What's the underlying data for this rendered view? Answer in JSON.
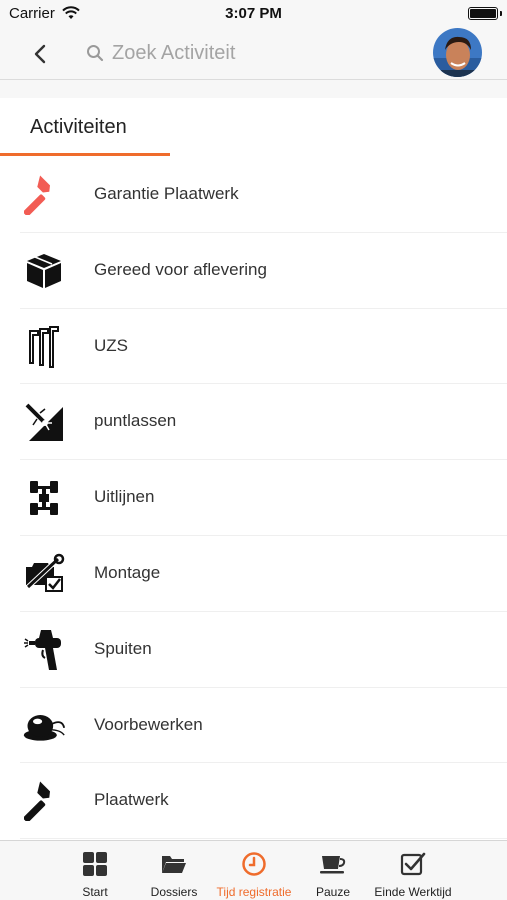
{
  "status_bar": {
    "carrier": "Carrier",
    "time": "3:07 PM"
  },
  "nav": {
    "search_placeholder": "Zoek Activiteit"
  },
  "section": {
    "title": "Activiteiten",
    "accent_color": "#ef6c2c"
  },
  "activities": [
    {
      "label": "Garantie Plaatwerk",
      "icon": "hammer-icon",
      "icon_color": "#f25c54"
    },
    {
      "label": "Gereed voor aflevering",
      "icon": "box-icon",
      "icon_color": "#111111"
    },
    {
      "label": "UZS",
      "icon": "hex-keys-icon",
      "icon_color": "#111111"
    },
    {
      "label": "puntlassen",
      "icon": "spot-welding-icon",
      "icon_color": "#111111"
    },
    {
      "label": "Uitlijnen",
      "icon": "wheel-alignment-icon",
      "icon_color": "#111111"
    },
    {
      "label": "Montage",
      "icon": "engine-wrench-icon",
      "icon_color": "#111111"
    },
    {
      "label": "Spuiten",
      "icon": "spray-gun-icon",
      "icon_color": "#111111"
    },
    {
      "label": "Voorbewerken",
      "icon": "sander-icon",
      "icon_color": "#111111"
    },
    {
      "label": "Plaatwerk",
      "icon": "hammer-icon",
      "icon_color": "#111111"
    }
  ],
  "tabs": [
    {
      "label": "Start",
      "icon": "grid-icon"
    },
    {
      "label": "Dossiers",
      "icon": "folder-icon"
    },
    {
      "label": "Tijd registratie",
      "icon": "clock-icon",
      "active": true
    },
    {
      "label": "Pauze",
      "icon": "coffee-cup-icon"
    },
    {
      "label": "Einde Werktijd",
      "icon": "checkbox-icon"
    }
  ]
}
